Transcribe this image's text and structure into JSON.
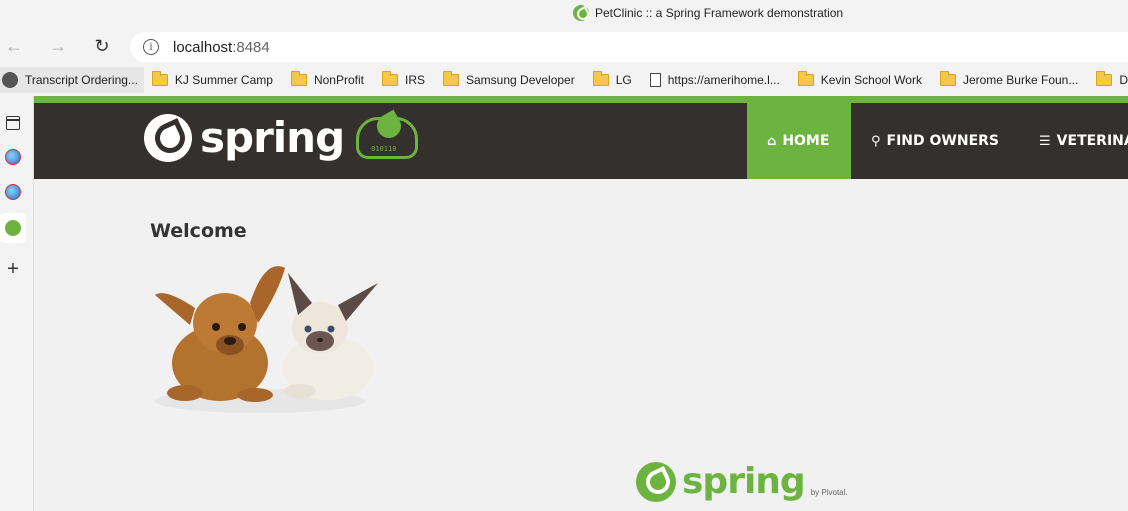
{
  "window": {
    "title": "PetClinic :: a Spring Framework demonstration"
  },
  "nav": {
    "back_icon": "back-arrow-icon",
    "forward_icon": "forward-arrow-icon",
    "reload_icon": "reload-icon",
    "address_host": "localhost",
    "address_port": ":8484"
  },
  "bookmarks": [
    {
      "label": "Transcript Ordering...",
      "icon": "site-icon"
    },
    {
      "label": "KJ Summer Camp",
      "icon": "folder-icon"
    },
    {
      "label": "NonProfit",
      "icon": "folder-icon"
    },
    {
      "label": "IRS",
      "icon": "folder-icon"
    },
    {
      "label": "Samsung Developer",
      "icon": "folder-icon"
    },
    {
      "label": "LG",
      "icon": "folder-icon"
    },
    {
      "label": "https://amerihome.l...",
      "icon": "page-icon"
    },
    {
      "label": "Kevin School Work",
      "icon": "folder-icon"
    },
    {
      "label": "Jerome Burke Foun...",
      "icon": "folder-icon"
    },
    {
      "label": "Data",
      "icon": "folder-icon"
    }
  ],
  "site": {
    "logo_text": "spring",
    "cloud_bits": "010110",
    "menu": [
      {
        "label": "HOME",
        "icon": "home-icon",
        "active": true
      },
      {
        "label": "FIND OWNERS",
        "icon": "search-icon",
        "active": false
      },
      {
        "label": "VETERINARIANS",
        "icon": "list-icon",
        "active": false
      }
    ],
    "welcome": "Welcome",
    "footer_logo_text": "spring",
    "footer_by": "by Pivotal."
  },
  "colors": {
    "brand_green": "#6db33f",
    "navbar_bg": "#34302d"
  }
}
